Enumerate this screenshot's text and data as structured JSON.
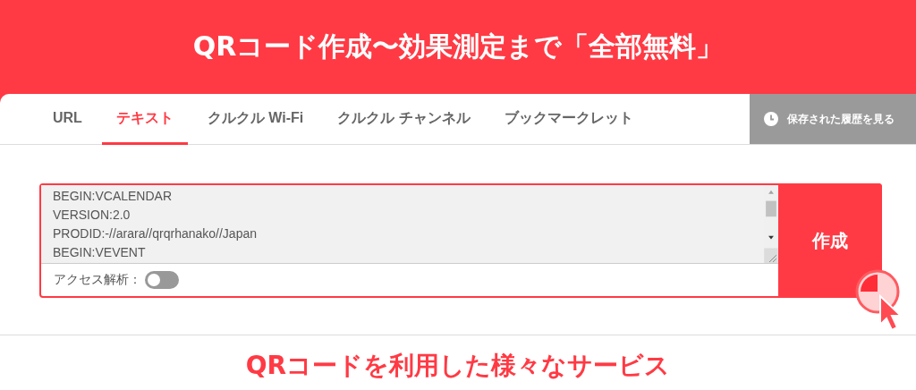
{
  "header": {
    "title": "QRコード作成〜効果測定まで「全部無料」"
  },
  "tabs": [
    {
      "label": "URL",
      "selected": false
    },
    {
      "label": "テキスト",
      "selected": true
    },
    {
      "label": "クルクル Wi-Fi",
      "selected": false
    },
    {
      "label": "クルクル チャンネル",
      "selected": false
    },
    {
      "label": "ブックマークレット",
      "selected": false
    }
  ],
  "history_button": {
    "label": "保存された履歴を見る"
  },
  "text_input": {
    "value": "BEGIN:VCALENDAR\nVERSION:2.0\nPRODID:-//arara//qrqrhanako//Japan\nBEGIN:VEVENT"
  },
  "access_analysis": {
    "label": "アクセス解析：",
    "on": false
  },
  "create_button": {
    "label": "作成"
  },
  "section_heading": "QRコードを利用した様々なサービス"
}
